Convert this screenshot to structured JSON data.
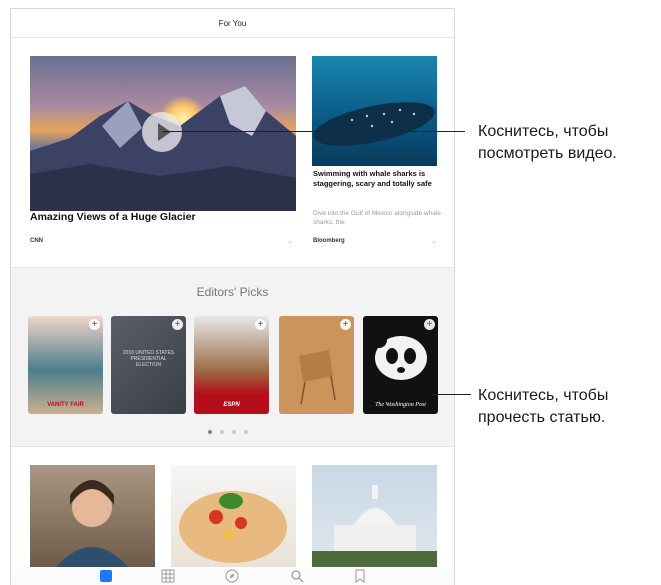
{
  "header": {
    "title": "For You"
  },
  "stories": [
    {
      "headline": "Amazing Views of a Huge Glacier",
      "source": "CNN"
    },
    {
      "headline": "Swimming with whale sharks is staggering, scary and totally safe",
      "description": "Dive into the Gulf of Mexico alongside whale sharks, the",
      "source": "Bloomberg"
    }
  ],
  "editors_picks": {
    "title": "Editors' Picks",
    "magazines": [
      {
        "label": "VANITY FAIR"
      },
      {
        "label": "2016 UNITED STATES PRESIDENTIAL ELECTION"
      },
      {
        "label": "ESPN"
      },
      {
        "label": ""
      },
      {
        "label": "The Washington Post"
      }
    ],
    "page_dots": 4,
    "active_dot": 0
  },
  "callouts": {
    "video": "Коснитесь, чтобы посмотреть видео.",
    "article": "Коснитесь, чтобы прочесть статью."
  },
  "tab_icons": [
    "for-you-icon",
    "channels-icon",
    "explore-icon",
    "search-icon",
    "saved-icon"
  ]
}
